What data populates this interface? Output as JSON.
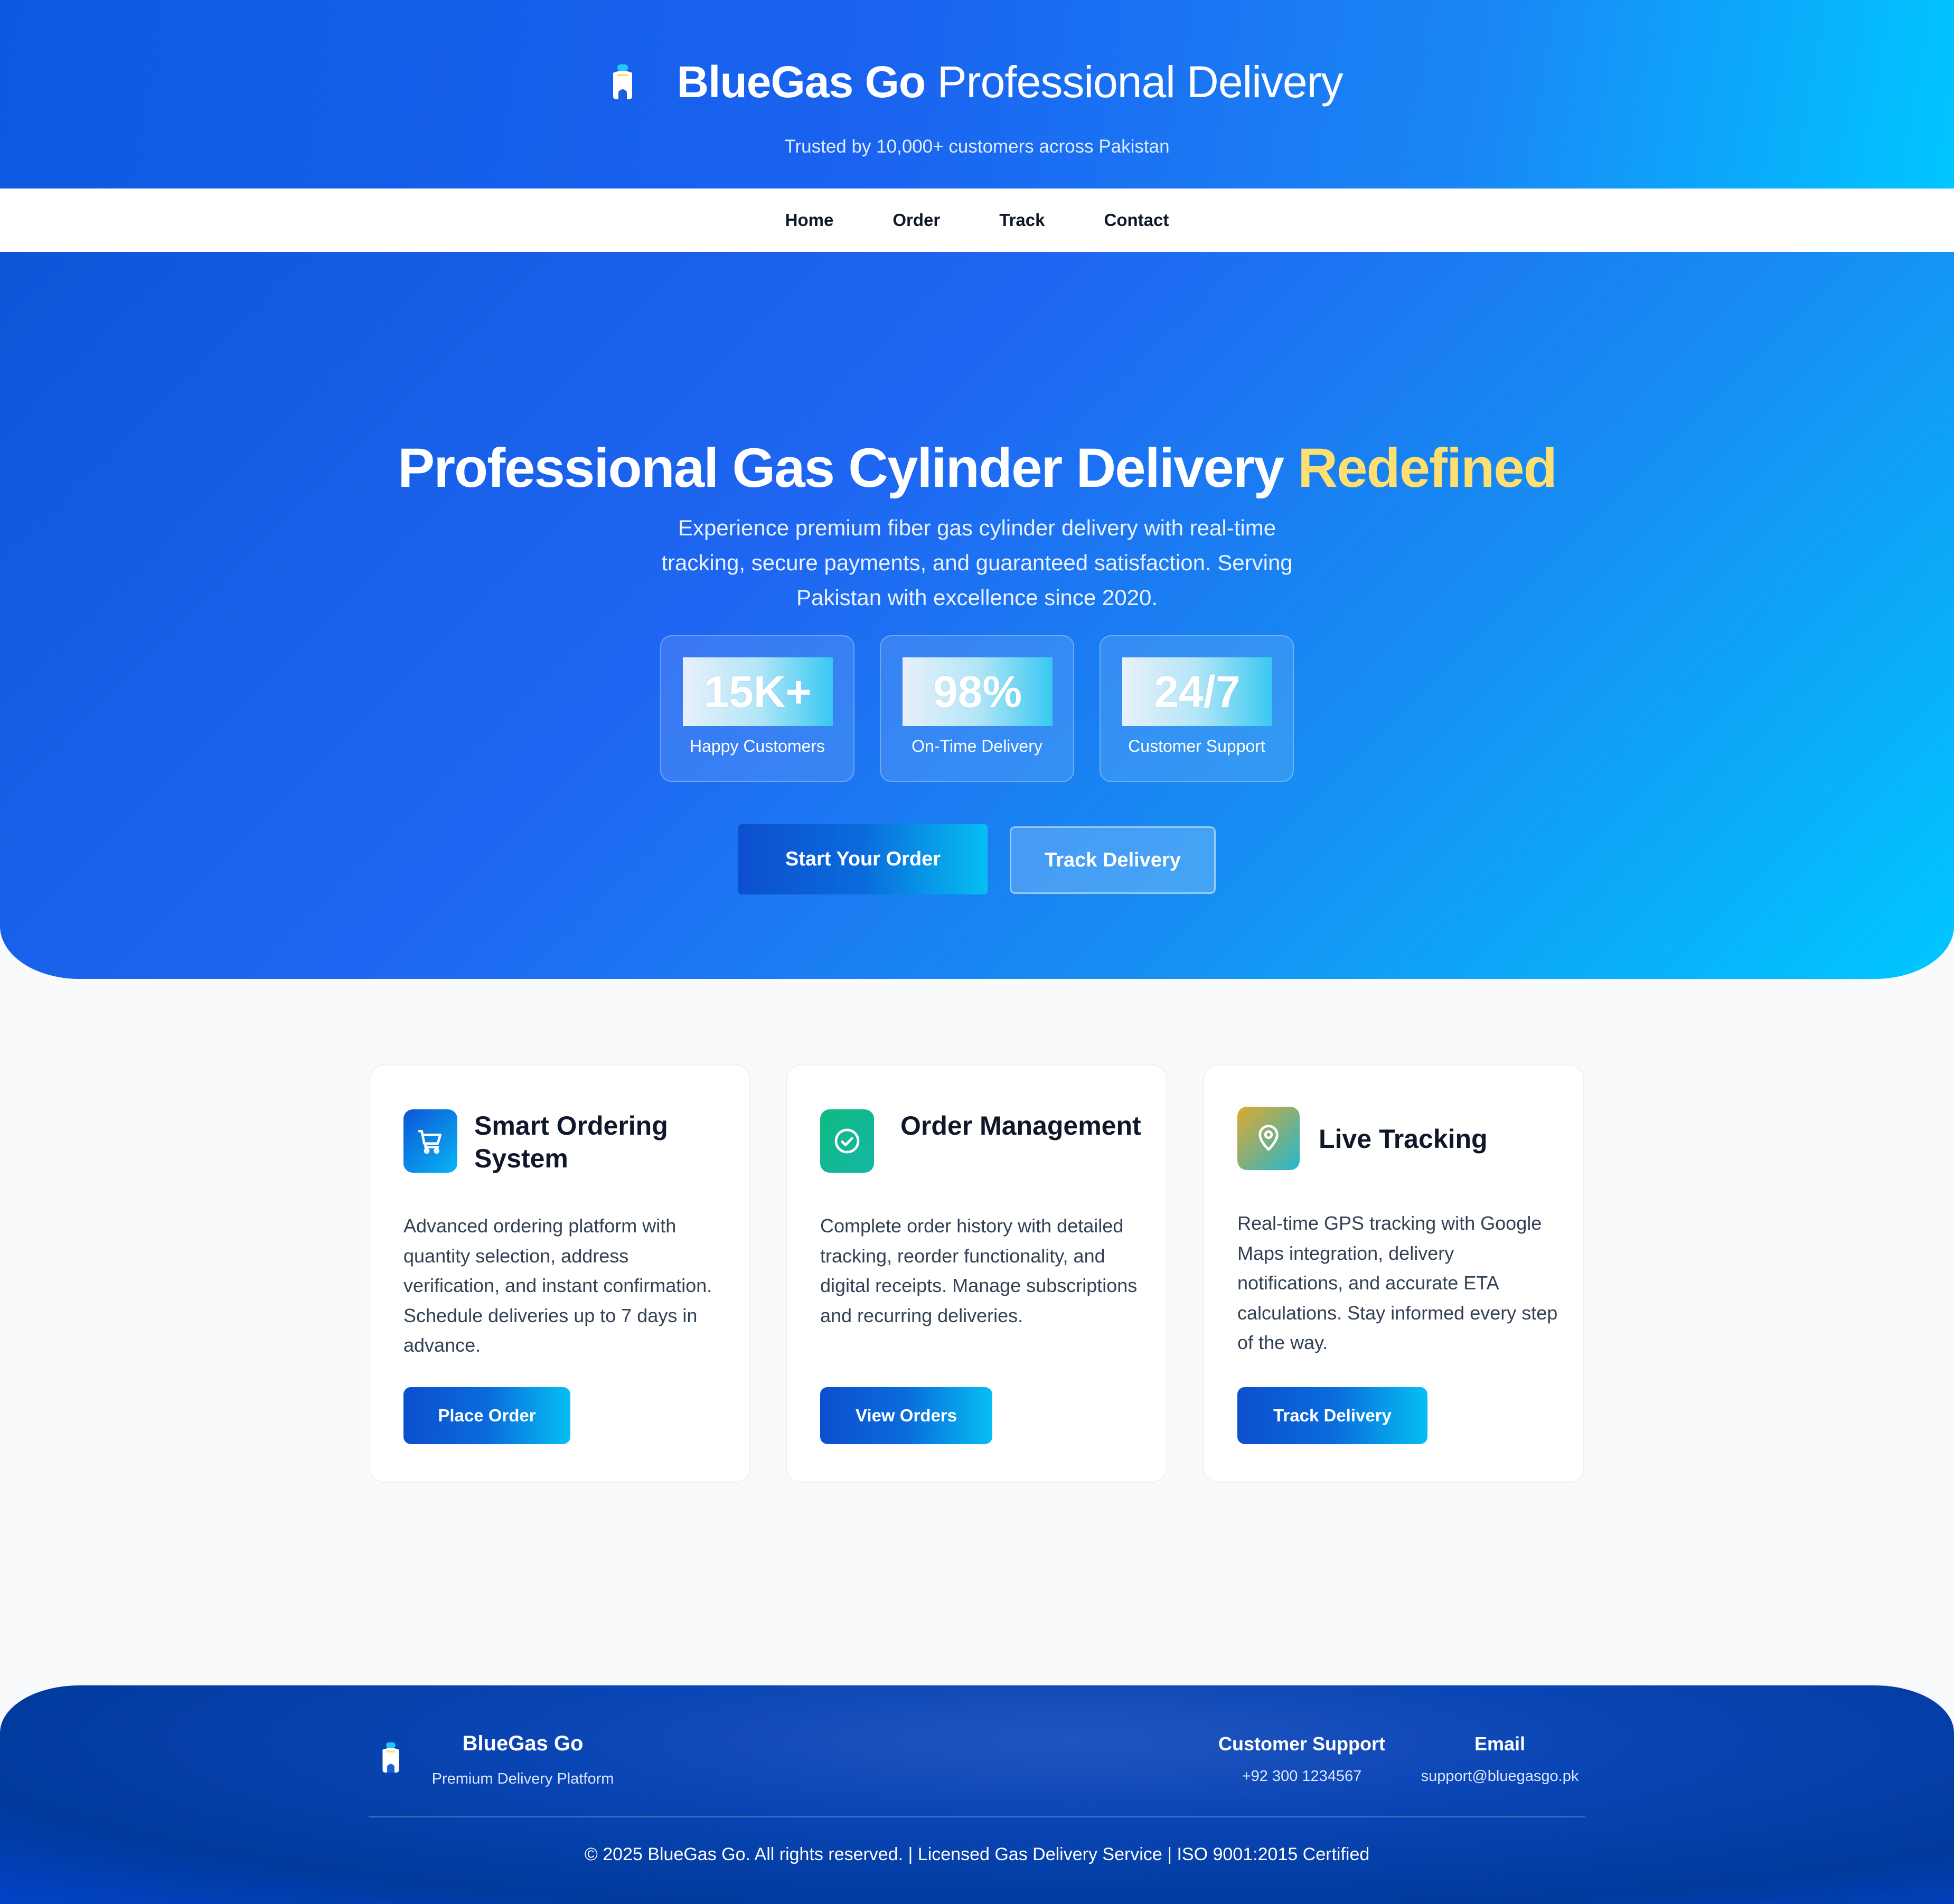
{
  "header": {
    "brand_bold": "BlueGas Go",
    "brand_rest": "Professional Delivery",
    "tagline": "Trusted by 10,000+ customers across Pakistan",
    "logo_icon": "gas-cylinder-icon"
  },
  "nav": {
    "items": [
      {
        "label": "Home"
      },
      {
        "label": "Order"
      },
      {
        "label": "Track"
      },
      {
        "label": "Contact"
      }
    ]
  },
  "hero": {
    "title_main": "Professional Gas Cylinder Delivery",
    "title_accent": "Redefined",
    "subtitle": "Experience premium fiber gas cylinder delivery with real-time tracking, secure payments, and guaranteed satisfaction. Serving Pakistan with excellence since 2020.",
    "stats": [
      {
        "value": "15K+",
        "label": "Happy Customers"
      },
      {
        "value": "98%",
        "label": "On-Time Delivery"
      },
      {
        "value": "24/7",
        "label": "Customer Support"
      }
    ],
    "primary_button": "Start Your Order",
    "secondary_button": "Track Delivery",
    "accent_color": "#fde071"
  },
  "features": [
    {
      "icon": "cart-icon",
      "title": "Smart Ordering System",
      "description": "Advanced ordering platform with quantity selection, address verification, and instant confirmation. Schedule deliveries up to 7 days in advance.",
      "button": "Place Order"
    },
    {
      "icon": "check-circle-icon",
      "title": "Order Management",
      "description": "Complete order history with detailed tracking, reorder functionality, and digital receipts. Manage subscriptions and recurring deliveries.",
      "button": "View Orders"
    },
    {
      "icon": "map-pin-icon",
      "title": "Live Tracking",
      "description": "Real-time GPS tracking with Google Maps integration, delivery notifications, and accurate ETA calculations. Stay informed every step of the way.",
      "button": "Track Delivery"
    }
  ],
  "footer": {
    "brand": "BlueGas Go",
    "brand_sub": "Premium Delivery Platform",
    "support_title": "Customer Support",
    "support_phone": "+92 300 1234567",
    "email_title": "Email",
    "email_value": "support@bluegasgo.pk",
    "copyright": "© 2025 BlueGas Go. All rights reserved. | Licensed Gas Delivery Service | ISO 9001:2015 Certified"
  }
}
